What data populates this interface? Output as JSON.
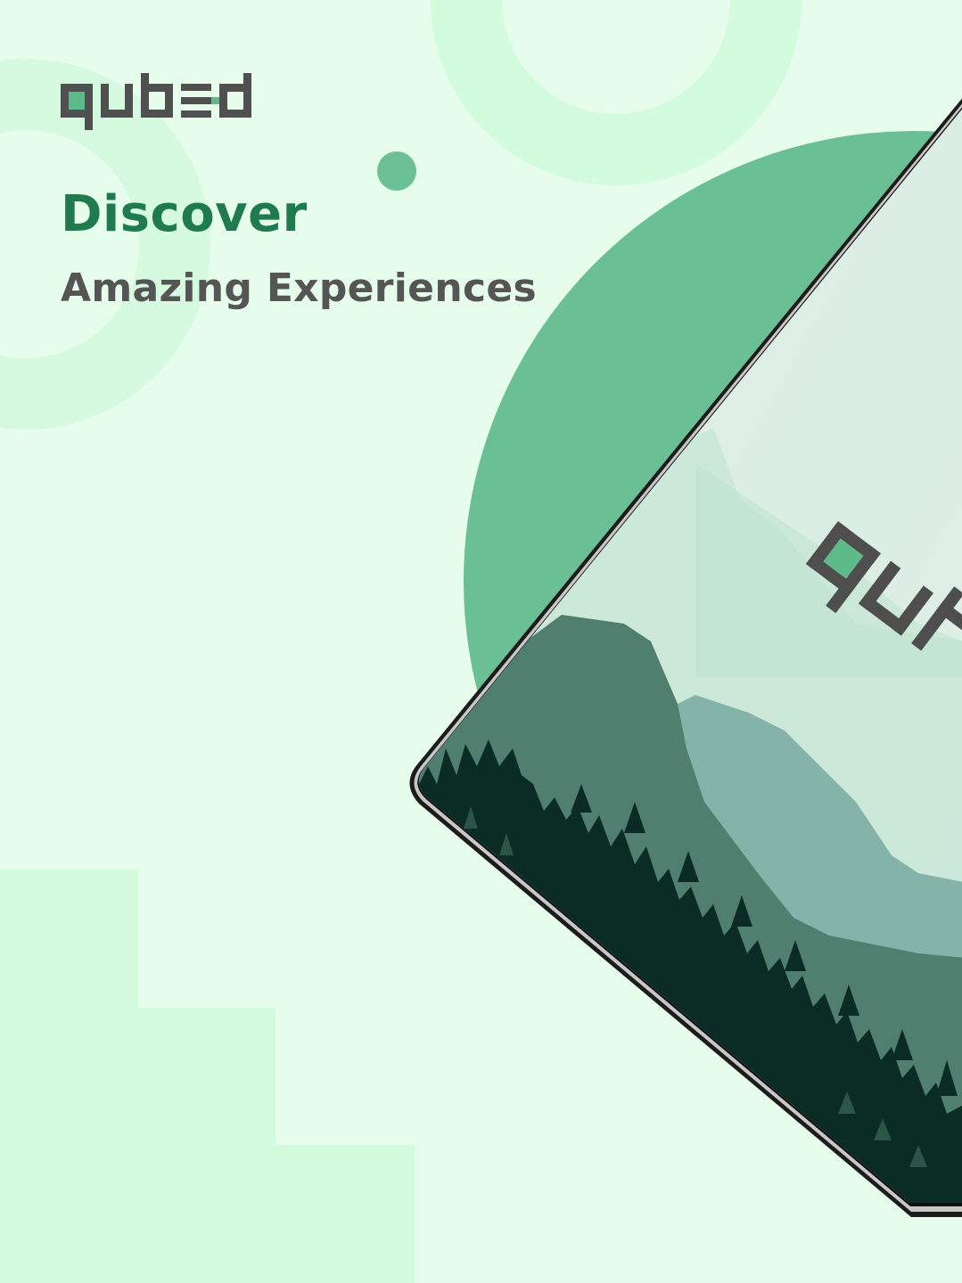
{
  "brand": {
    "name": "qubed",
    "screen_logo_text": "qub"
  },
  "hero": {
    "title": "Discover",
    "subtitle": "Amazing Experiences"
  },
  "colors": {
    "background": "#e6fdeb",
    "accent_green": "#6bbf95",
    "title_green": "#1f7a4d",
    "text_gray": "#555555",
    "logo_gray": "#505050",
    "logo_green": "#5dbb8a",
    "forest_dark": "#0a2c24"
  }
}
